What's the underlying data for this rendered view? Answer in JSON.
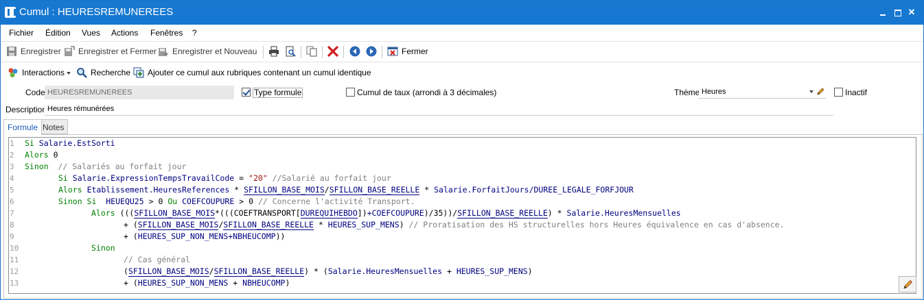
{
  "window": {
    "title": "Cumul : HEURESREMUNEREES",
    "minimize_icon": "minimize-icon",
    "maximize_icon": "maximize-icon",
    "close_label": "✕"
  },
  "menu": [
    "Fichier",
    "Édition",
    "Vues",
    "Actions",
    "Fenêtres",
    "?"
  ],
  "toolbar": {
    "save": "Enregistrer",
    "save_close": "Enregistrer et Fermer",
    "save_new": "Enregistrer et Nouveau",
    "close": "Fermer"
  },
  "toolbar2": {
    "interactions": "Interactions",
    "search": "Recherche",
    "add_cumul": "Ajouter ce cumul aux rubriques contenant un cumul identique"
  },
  "form": {
    "code_label": "Code",
    "code_value": "HEURESREMUNEREES",
    "type_formule_label": "Type formule",
    "type_formule_checked": true,
    "cumul_taux_label": "Cumul de taux (arrondi à 3 décimales)",
    "cumul_taux_checked": false,
    "theme_label": "Thème",
    "theme_value": "Heures",
    "inactif_label": "Inactif",
    "inactif_checked": false,
    "description_label": "Description",
    "description_value": "Heures rémunérées"
  },
  "tabs": [
    "Formule",
    "Notes"
  ],
  "editor": {
    "line_numbers": [
      "1",
      "2",
      "3",
      "4",
      "5",
      "6",
      "7",
      "8",
      "9",
      "10",
      "11",
      "12",
      "13"
    ]
  },
  "colors": {
    "titlebar": "#1778d1",
    "keyword": "#008000",
    "identifier": "#000080",
    "string": "#a31515",
    "comment": "#808080"
  }
}
